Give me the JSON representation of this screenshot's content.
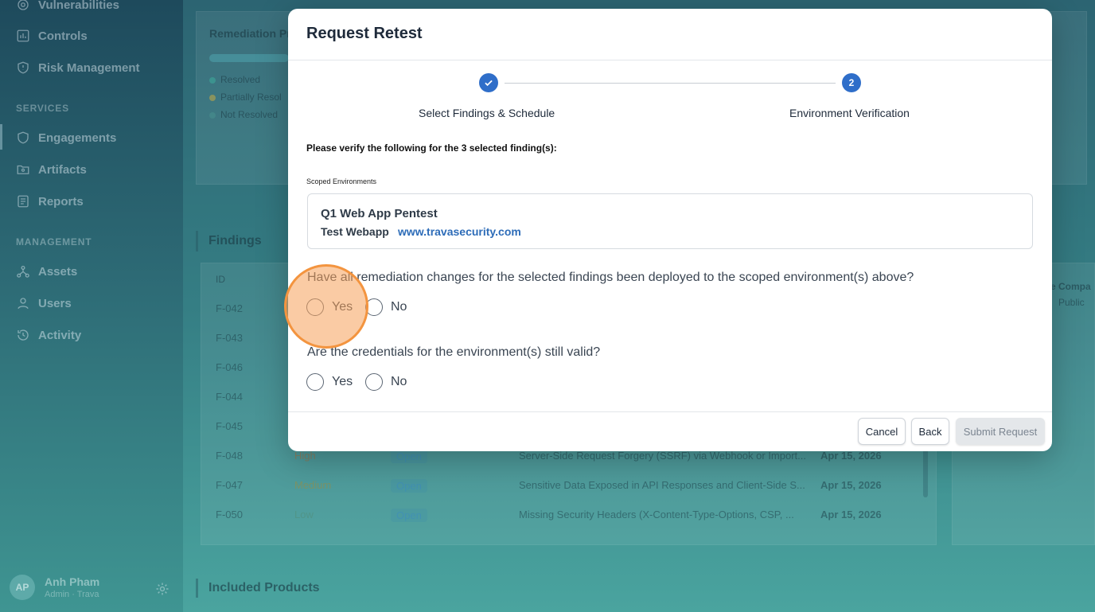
{
  "sidebar": {
    "top_items": [
      {
        "label": "Vulnerabilities",
        "icon": "gear-icon"
      },
      {
        "label": "Controls",
        "icon": "chart-icon"
      },
      {
        "label": "Risk Management",
        "icon": "shield-icon"
      }
    ],
    "services_label": "SERVICES",
    "services_items": [
      {
        "label": "Engagements",
        "icon": "shield-icon"
      },
      {
        "label": "Artifacts",
        "icon": "folder-icon"
      },
      {
        "label": "Reports",
        "icon": "document-icon"
      }
    ],
    "management_label": "MANAGEMENT",
    "management_items": [
      {
        "label": "Assets",
        "icon": "network-icon"
      },
      {
        "label": "Users",
        "icon": "user-icon"
      },
      {
        "label": "Activity",
        "icon": "history-icon"
      }
    ],
    "user": {
      "initials": "AP",
      "name": "Anh Pham",
      "role": "Admin · Trava"
    }
  },
  "background": {
    "remediation_title": "Remediation Pr",
    "legend": [
      "Resolved",
      "Partially Resol",
      "Not Resolved"
    ],
    "findings_title": "Findings",
    "id_header": "ID",
    "rows": [
      {
        "id": "F-042"
      },
      {
        "id": "F-043"
      },
      {
        "id": "F-046"
      },
      {
        "id": "F-044"
      },
      {
        "id": "F-045"
      },
      {
        "id": "F-048",
        "severity": "High",
        "status": "Open",
        "title": "Server-Side Request Forgery (SSRF) via Webhook or Import...",
        "date": "Apr 15, 2026"
      },
      {
        "id": "F-047",
        "severity": "Medium",
        "status": "Open",
        "title": "Sensitive Data Exposed in API Responses and Client-Side S...",
        "date": "Apr 15, 2026"
      },
      {
        "id": "F-050",
        "severity": "Low",
        "status": "Open",
        "title": "Missing Security Headers (X-Content-Type-Options, CSP, ...",
        "date": "Apr 15, 2026"
      }
    ],
    "right_col_title": "e Compa",
    "right_col_sub": "Public",
    "included_products": "Included Products"
  },
  "modal": {
    "title": "Request Retest",
    "steps": [
      {
        "label": "Select Findings & Schedule",
        "state": "complete"
      },
      {
        "label": "Environment Verification",
        "number": "2",
        "state": "active"
      }
    ],
    "verify_title": "Please verify the following for the 3 selected finding(s):",
    "scoped_label": "Scoped Environments",
    "environment": {
      "name": "Q1 Web App Pentest",
      "app": "Test Webapp",
      "url": "www.travasecurity.com"
    },
    "q1": {
      "text": "Have all remediation changes for the selected findings been deployed to the scoped environment(s) above?",
      "yes": "Yes",
      "no": "No"
    },
    "q2": {
      "text": "Are the credentials for the environment(s) still valid?",
      "yes": "Yes",
      "no": "No"
    },
    "buttons": {
      "cancel": "Cancel",
      "back": "Back",
      "submit": "Submit Request"
    }
  },
  "colors": {
    "accent": "#2f6ec9",
    "link": "#2d6cb8",
    "highlight": "#f3943f"
  }
}
